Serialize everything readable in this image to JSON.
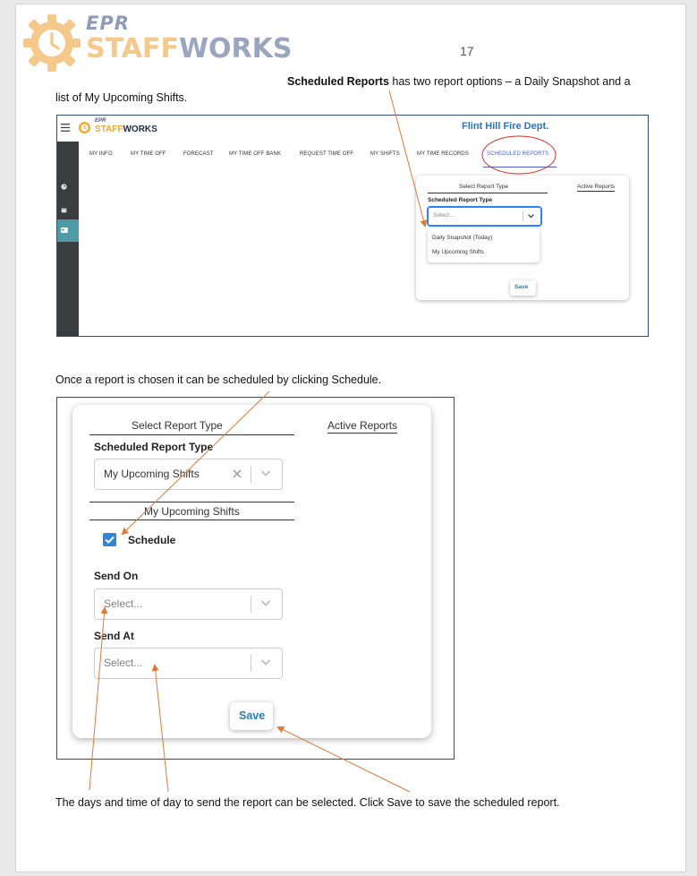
{
  "logo": {
    "epr": "EPR",
    "staff": "STAFF",
    "works": "WORKS"
  },
  "page_number": "17",
  "intro": {
    "bold": "Scheduled Reports",
    "rest_line1": " has two report options – a Daily Snapshot and a",
    "line2": "list of My Upcoming Shifts."
  },
  "screenshot1": {
    "app_logo_epr": "EPR",
    "app_logo_staff": "STAFF",
    "app_logo_works": "WORKS",
    "department": "Flint Hill Fire Dept.",
    "menu_icon": "hamburger-icon",
    "nav": [
      "MY INFO",
      "MY TIME OFF",
      "FORECAST",
      "MY TIME OFF BANK",
      "REQUEST TIME OFF",
      "MY SHIFTS",
      "MY TIME RECORDS",
      "SCHEDULED REPORTS"
    ],
    "tabs": {
      "select": "Select Report Type",
      "active": "Active Reports"
    },
    "field_label": "Scheduled Report Type",
    "placeholder": "Select...",
    "options": [
      "Daily Snapshot (Today)",
      "My Upcoming Shifts"
    ],
    "save": "Save",
    "accent": "#4e9aa6",
    "dept_color": "#2e73c7"
  },
  "middle_text": "Once a report is chosen it can be scheduled by clicking Schedule.",
  "screenshot2": {
    "tabs": {
      "select": "Select Report Type",
      "active": "Active Reports"
    },
    "field_label": "Scheduled Report Type",
    "selected_value": "My Upcoming Shifts",
    "section_title": "My Upcoming Shifts",
    "schedule_label": "Schedule",
    "schedule_checked": true,
    "send_on_label": "Send On",
    "send_on_placeholder": "Select...",
    "send_at_label": "Send At",
    "send_at_placeholder": "Select...",
    "save": "Save",
    "checkbox_color": "#2f86d8",
    "save_color": "#2b7fae"
  },
  "footer_text": "The days and time of day to send the report can be selected. Click Save to save the scheduled report.",
  "annotation_color": "#e07a3a"
}
